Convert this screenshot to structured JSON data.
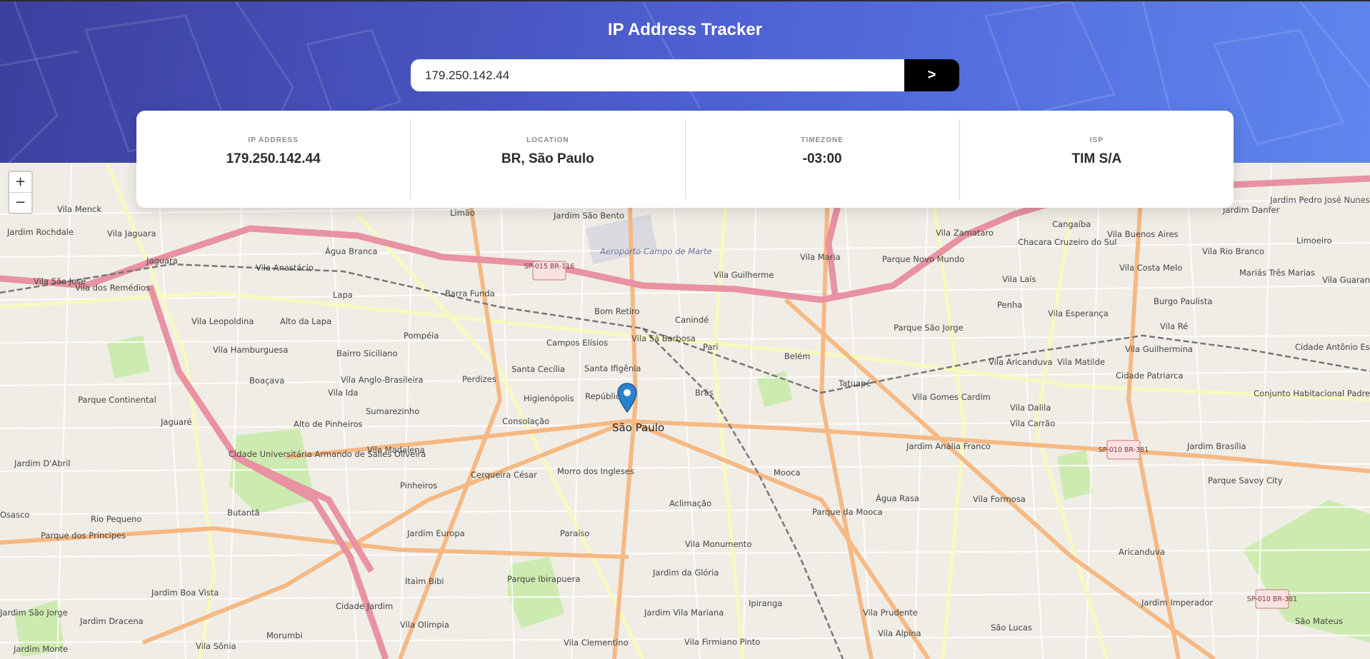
{
  "app": {
    "title": "IP Address Tracker"
  },
  "search": {
    "value": "179.250.142.44",
    "submit_label": ">"
  },
  "info": [
    {
      "label": "IP ADDRESS",
      "value": "179.250.142.44"
    },
    {
      "label": "LOCATION",
      "value": "BR, São Paulo"
    },
    {
      "label": "TIMEZONE",
      "value": "-03:00"
    },
    {
      "label": "ISP",
      "value": "TIM S/A"
    }
  ],
  "map": {
    "zoom_in": "+",
    "zoom_out": "−",
    "center_label": "São Paulo",
    "districts": [
      "Vila Menck",
      "Jardim Rochdale",
      "Vila Jaguara",
      "Jaguara",
      "Vila Anastácio",
      "Água Branca",
      "Limão",
      "Jardim São Bento",
      "Vila Maria",
      "Parque Novo Mundo",
      "Vila Zamataro",
      "Cangaíba",
      "Chacara Cruzeiro do Sul",
      "Vila Buenos Aires",
      "Jardim Danfer",
      "Jardim Pedro José Nunes",
      "Limoeiro",
      "Vila Rio Branco",
      "Vila Costa Melo",
      "Mariás Três Marias",
      "Vila Guarani",
      "Vila São José",
      "Vila dos Remédios",
      "Lapa",
      "Barra Funda",
      "Bom Retiro",
      "Canindé",
      "Vila Guilherme",
      "Vila Laís",
      "Penha",
      "Vila Esperança",
      "Burgo Paulista",
      "Vila Leopoldina",
      "Alto da Lapa",
      "Pompéia",
      "Campos Elísios",
      "Vila Sá Barbosa",
      "Parque São Jorge",
      "Vila Ré",
      "Vila Hamburguesa",
      "Bairro Siciliano",
      "Santa Cecília",
      "Santa Ifigênia",
      "Pari",
      "Belém",
      "Vila Aricanduva",
      "Vila Matilde",
      "Vila Guilhermina",
      "Cidade Antônio Estêvão de Carvalho",
      "Boaçava",
      "Vila Anglo-Brasileira",
      "Perdizes",
      "Tatuapé",
      "Cidade Patriarca",
      "Parque Continental",
      "Vila Ida",
      "Sumarezinho",
      "Higienópolis",
      "República",
      "Brás",
      "Vila Gomes Cardim",
      "Vila Dalila",
      "Conjunto Habitacional Padre Manoel da Nóbrega",
      "Jaguaré",
      "Alto de Pinheiros",
      "Consolação",
      "Vila Carrão",
      "Jardim D'Abril",
      "Vila Madalena",
      "Jardim Anália Franco",
      "Jardim Brasília",
      "Cidade Universitária Armando de Salles Oliveira",
      "Pinheiros",
      "Cerqueira César",
      "Morro dos Ingleses",
      "Mooca",
      "Água Rasa",
      "Vila Formosa",
      "Parque Savoy City",
      "Osasco",
      "Rio Pequeno",
      "Butantã",
      "Aclimação",
      "Parque da Mooca",
      "Parque dos Príncipes",
      "Jardim Europa",
      "Paraíso",
      "Vila Monumento",
      "Aricanduva",
      "Itaim Bibi",
      "Parque Ibirapuera",
      "Jardim da Glória",
      "Jardim Boa Vista",
      "Jardim Dracena",
      "Cidade Jardim",
      "Vila Olímpia",
      "Jardim Vila Mariana",
      "Ipiranga",
      "Vila Prudente",
      "Jardim Imperador",
      "Jardim São Jorge",
      "Jardim Monte",
      "Morumbi",
      "Vila Sônia",
      "Vila Clementino",
      "Vila Firmiano Pinto",
      "Vila Alpina",
      "São Lucas",
      "São Mateus",
      "Aeroporto Campo de Marte"
    ],
    "road_labels": [
      "SP-015 BR-116",
      "SP-010 BR-381",
      "SP-010 BR-381"
    ]
  },
  "colors": {
    "header_start": "#3d3f9e",
    "header_end": "#5f86ee",
    "button": "#000000",
    "map_bg": "#f2efe9",
    "motorway": "#e892a2",
    "primary_road": "#fcd6a4",
    "park": "#cdebb0",
    "pin": "#2a81cb"
  }
}
